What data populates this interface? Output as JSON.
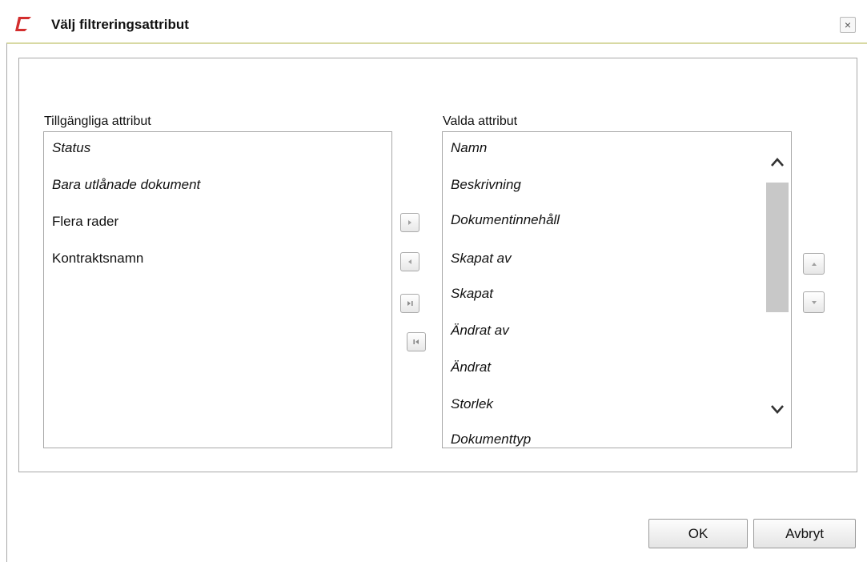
{
  "dialog": {
    "title": "Välj filtreringsattribut",
    "close_label": "×",
    "brand_color": "#d32e2e"
  },
  "available": {
    "label": "Tillgängliga attribut",
    "items": [
      {
        "label": "Status",
        "italic": true
      },
      {
        "label": "Bara utlånade dokument",
        "italic": true
      },
      {
        "label": "Flera rader",
        "italic": false
      },
      {
        "label": "Kontraktsnamn",
        "italic": false
      }
    ]
  },
  "selected": {
    "label": "Valda attribut",
    "items": [
      {
        "label": "Namn",
        "italic": true
      },
      {
        "label": "Beskrivning",
        "italic": true
      },
      {
        "label": "Dokumentinnehåll",
        "italic": true
      },
      {
        "label": "Skapat av",
        "italic": true
      },
      {
        "label": "Skapat",
        "italic": true
      },
      {
        "label": "Ändrat av",
        "italic": true
      },
      {
        "label": "Ändrat",
        "italic": true
      },
      {
        "label": "Storlek",
        "italic": true
      },
      {
        "label": "Dokumenttyp",
        "italic": true
      }
    ]
  },
  "transfer_buttons": [
    {
      "name": "move-right-button",
      "icon": "triangle-right-icon"
    },
    {
      "name": "move-left-button",
      "icon": "triangle-left-icon"
    },
    {
      "name": "move-all-right-button",
      "icon": "skip-right-icon"
    },
    {
      "name": "move-all-left-button",
      "icon": "skip-left-icon"
    }
  ],
  "order_buttons": [
    {
      "name": "move-up-button",
      "icon": "triangle-up-icon"
    },
    {
      "name": "move-down-button",
      "icon": "triangle-down-icon"
    }
  ],
  "footer": {
    "ok_label": "OK",
    "cancel_label": "Avbryt"
  }
}
